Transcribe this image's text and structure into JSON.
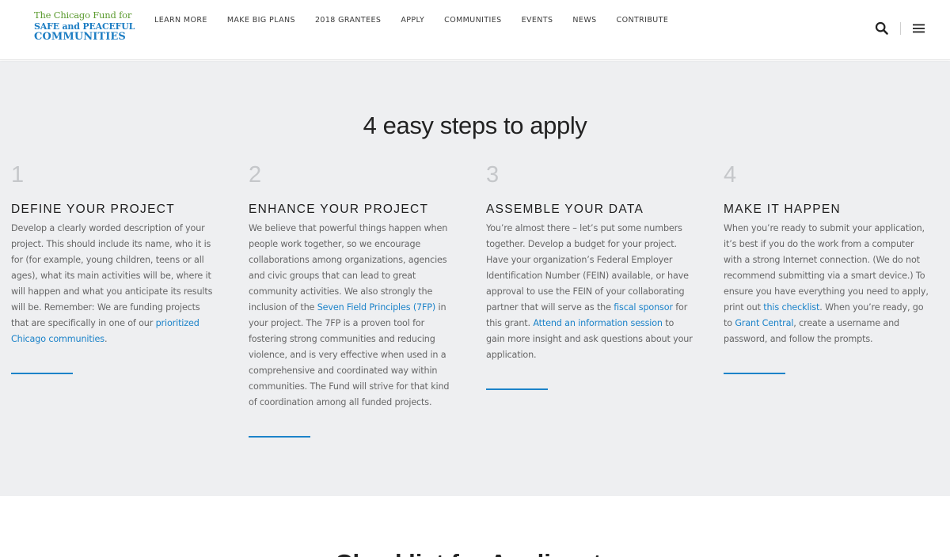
{
  "logo": {
    "line1": "The Chicago Fund for",
    "line2": "SAFE and PEACEFUL",
    "line3": "COMMUNITIES"
  },
  "nav": {
    "items": [
      "LEARN MORE",
      "MAKE BIG PLANS",
      "2018 GRANTEES",
      "APPLY",
      "COMMUNITIES",
      "EVENTS",
      "NEWS",
      "CONTRIBUTE"
    ]
  },
  "header_icons": [
    "search-icon",
    "hamburger-menu-icon"
  ],
  "section": {
    "title": "4 easy steps to apply"
  },
  "steps": [
    {
      "number": "1",
      "title": "DEFINE YOUR PROJECT",
      "body": [
        {
          "t": "text",
          "v": "Develop a clearly worded description of your project. This should include its name, who it is for (for example, young children, teens or all ages), what its main activities will be, where it will happen and what you anticipate its results will be. Remember: We are funding projects that are specifically in one of our "
        },
        {
          "t": "link",
          "v": "prioritized Chicago communities"
        },
        {
          "t": "text",
          "v": "."
        }
      ]
    },
    {
      "number": "2",
      "title": "ENHANCE YOUR PROJECT",
      "body": [
        {
          "t": "text",
          "v": "We believe that powerful things happen when people work together, so we encourage collaborations among organizations, agencies and civic groups that can lead to great community activities. We also strongly the inclusion of the "
        },
        {
          "t": "link",
          "v": "Seven Field Principles (7FP)"
        },
        {
          "t": "text",
          "v": " in your project. The 7FP is a proven tool for fostering strong communities and reducing violence, and is very effective when used in a comprehensive and coordinated way within communities. The Fund will strive for that kind of coordination among all funded projects."
        }
      ]
    },
    {
      "number": "3",
      "title": "ASSEMBLE YOUR DATA",
      "body": [
        {
          "t": "text",
          "v": "You’re almost there – let’s put some numbers together. Develop a budget for your project. Have your organization’s Federal Employer Identification Number (FEIN) available, or have approval to use the FEIN of your collaborating partner that will serve as the "
        },
        {
          "t": "link",
          "v": "fiscal sponsor"
        },
        {
          "t": "text",
          "v": " for this grant. "
        },
        {
          "t": "link",
          "v": "Attend an information session"
        },
        {
          "t": "text",
          "v": " to gain more insight and ask questions about your application."
        }
      ]
    },
    {
      "number": "4",
      "title": "MAKE IT HAPPEN",
      "body": [
        {
          "t": "text",
          "v": "When you’re ready to submit your application, it’s best if you do the work from a computer with a strong Internet connection. (We do not recommend submitting via a smart device.) To ensure you have everything you need to apply, print out "
        },
        {
          "t": "link",
          "v": "this checklist"
        },
        {
          "t": "text",
          "v": ". When you’re ready, go to "
        },
        {
          "t": "link",
          "v": "Grant Central"
        },
        {
          "t": "text",
          "v": ", create a username and password, and follow the prompts."
        }
      ]
    }
  ],
  "next_section": {
    "title": "Checklist for Applicants"
  },
  "colors": {
    "accent": "#1c83c9",
    "logo_green": "#5a9a2e",
    "section_bg": "#eeeff1",
    "step_number": "#c5c7ca"
  }
}
